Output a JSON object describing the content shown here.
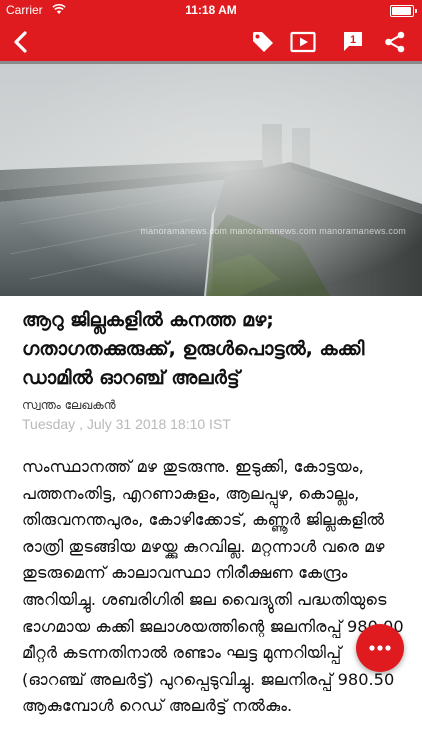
{
  "status_bar": {
    "carrier": "Carrier",
    "time": "11:18 AM",
    "battery_level": 1.0
  },
  "nav": {
    "background_color": "#e01b1f",
    "icons": [
      "back-arrow-icon",
      "tag-icon",
      "video-icon",
      "comment-icon",
      "share-icon"
    ]
  },
  "hero": {
    "watermark": "manoramanews.com  manoramanews.com  manoramanews.com"
  },
  "article": {
    "headline": "ആറു ജില്ലകളിൽ കനത്ത മഴ; ഗതാഗതക്കുരുക്ക്, ഉരുൾപൊട്ടൽ, കക്കി ഡാമിൽ ഓറഞ്ച് അലർട്ട്",
    "byline": "സ്വന്തം ലേഖകൻ",
    "dateline": "Tuesday , July 31 2018 18:10 IST",
    "body": "സംസ്ഥാനത്ത് മഴ തുടരുന്നു. ഇടുക്കി, കോട്ടയം, പത്തനംതിട്ട, എറണാകുളം, ആലപ്പുഴ, കൊല്ലം, തിരുവനന്തപുരം, കോഴിക്കോട്, കണ്ണൂർ ജില്ലകളിൽ രാത്രി തുടങ്ങിയ മഴയ്ക്കു കുറവില്ല. മറ്റന്നാൾ വരെ മഴ തുടരുമെന്ന് കാലാവസ്ഥാ നിരീക്ഷണ കേന്ദ്രം അറിയിച്ചു. ശബരിഗിരി ജല വൈദ്യുതി പദ്ധതിയുടെ ഭാഗമായ കക്കി ജലാശയത്തിന്റെ ജലനിരപ്പ് 980.00 മീറ്റർ കടന്നതിനാൽ രണ്ടാം ഘട്ട മുന്നറിയിപ്പ് (ഓറഞ്ച് അലർട്ട്) പുറപ്പെടുവിച്ചു. ജലനിരപ്പ് 980.50 ആകുമ്പോൾ റെഡ് അലർട്ട് നൽകും."
  },
  "fab": {
    "icon": "more-horizontal-icon"
  }
}
